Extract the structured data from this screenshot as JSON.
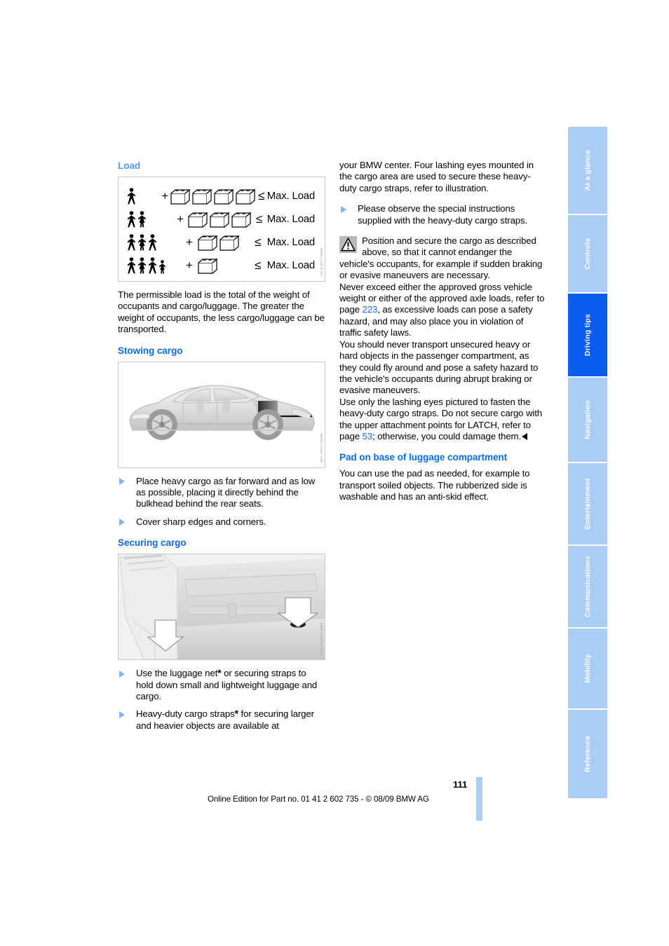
{
  "page": {
    "number": "111",
    "footer_text": "Online Edition for Part no. 01 41 2 602 735 - © 08/09 BMW AG"
  },
  "sidebar": {
    "tabs": [
      {
        "label": "At a glance",
        "active": false
      },
      {
        "label": "Controls",
        "active": false
      },
      {
        "label": "Driving tips",
        "active": true
      },
      {
        "label": "Navigation",
        "active": false
      },
      {
        "label": "Entertainment",
        "active": false
      },
      {
        "label": "Communications",
        "active": false
      },
      {
        "label": "Mobility",
        "active": false
      },
      {
        "label": "Reference",
        "active": false
      }
    ]
  },
  "left_column": {
    "load": {
      "heading": "Load",
      "figure": {
        "id_code": "BMW-Load-Chart",
        "rows": [
          {
            "people": 1,
            "boxes": 4,
            "plus": "+",
            "operator": "≤",
            "label": "Max. Load"
          },
          {
            "people": 2,
            "boxes": 3,
            "plus": "+",
            "operator": "≤",
            "label": "Max. Load"
          },
          {
            "people": 3,
            "boxes": 2,
            "plus": "+",
            "operator": "≤",
            "label": "Max. Load"
          },
          {
            "people": 4,
            "boxes": 1,
            "plus": "+",
            "operator": "≤",
            "label": "Max. Load"
          }
        ]
      },
      "paragraph": "The permissible load is the total of the weight of occupants and cargo/luggage. The greater the weight of occupants, the less cargo/luggage can be transported."
    },
    "stowing_cargo": {
      "heading": "Stowing cargo",
      "figure_id": "BMW-Coupe-Side",
      "bullets": [
        "Place heavy cargo as far forward and as low as possible, placing it directly behind the bulkhead behind the rear seats.",
        "Cover sharp edges and corners."
      ]
    },
    "securing_cargo": {
      "heading": "Securing cargo",
      "figure_id": "BMW-Lashing-Eyes",
      "bullets": [
        {
          "pre": "Use the luggage net",
          "asterisk": "*",
          "post": " or securing straps to hold down small and lightweight luggage and cargo."
        },
        {
          "pre": "Heavy-duty cargo straps",
          "asterisk": "*",
          "post": " for securing larger and heavier objects are available at"
        }
      ]
    }
  },
  "right_column": {
    "continuation": "your BMW center. Four lashing eyes mounted in the cargo area are used to secure these heavy-duty cargo straps, refer to illustration.",
    "bullet": "Please observe the special instructions supplied with the heavy-duty cargo straps.",
    "warning": {
      "icon": "warning-triangle-icon",
      "para1": "Position and secure the cargo as described above, so that it cannot endanger the vehicle's occupants, for example if sudden braking or evasive maneuvers are necessary.",
      "para2_a": "Never exceed either the approved gross vehicle weight or either of the approved axle loads, refer to page ",
      "para2_ref": "223",
      "para2_b": ", as excessive loads can pose a safety hazard, and may also place you in violation of traffic safety laws.",
      "para3": "You should never transport unsecured heavy or hard objects in the passenger compartment, as they could fly around and pose a safety hazard to the vehicle's occupants during abrupt braking or evasive maneuvers.",
      "para4_a": "Use only the lashing eyes pictured to fasten the heavy-duty cargo straps. Do not secure cargo with the upper attachment points for LATCH, refer to page ",
      "para4_ref": "53",
      "para4_b": "; otherwise, you could damage them."
    },
    "pad": {
      "heading": "Pad on base of luggage compartment",
      "paragraph": "You can use the pad as needed, for example to transport soiled objects. The rubberized side is washable and has an anti-skid effect."
    }
  },
  "colors": {
    "heading_blue": "#0a6cf0",
    "heading_blue_light": "#5a9bee",
    "tab_inactive": "#a9cdf4",
    "tab_active": "#0a5df0",
    "bullet_triangle": "#7fb4f5",
    "xref_link": "#1a6ef5"
  }
}
